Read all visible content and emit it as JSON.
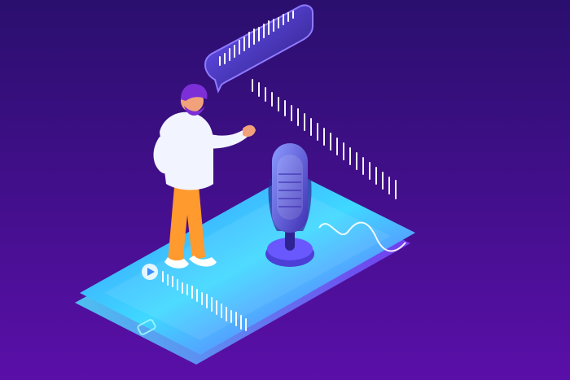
{
  "scene": {
    "description_free": true,
    "colors": {
      "background_top": "#2a0f6e",
      "background_bottom": "#5a0fa8",
      "phone_top": "#3a8cff",
      "phone_mid": "#3fd8ff",
      "phone_bottom": "#7a43ff",
      "phone_edge": "#4de0ff",
      "waveform": "#ffffff",
      "mic_body": "#5a6cff",
      "mic_dark": "#3f2fb3",
      "shirt": "#f2f4ff",
      "pants": "#ff9a2e",
      "hair": "#7c2fd6",
      "skin": "#f2a27a",
      "shoes": "#ffffff",
      "speech_bubble": "#6b57ff"
    },
    "icons": {
      "home_button": "home-button-icon",
      "play": "play-icon",
      "microphone": "microphone-icon",
      "speech_bubble": "speech-bubble-icon"
    }
  }
}
